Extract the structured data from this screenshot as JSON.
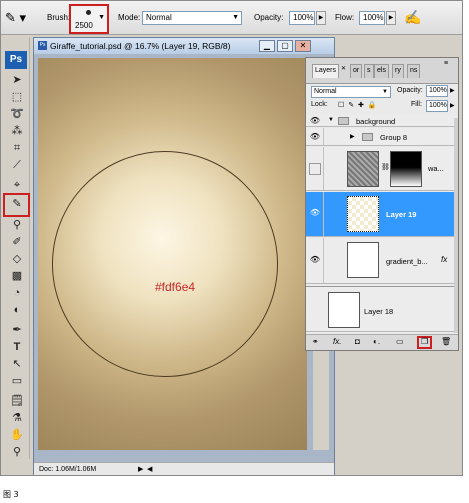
{
  "options_bar": {
    "brush_label": "Brush:",
    "brush_size": "2500",
    "mode_label": "Mode:",
    "mode_value": "Normal",
    "opacity_label": "Opacity:",
    "opacity_value": "100%",
    "flow_label": "Flow:",
    "flow_value": "100%"
  },
  "document": {
    "title": "Giraffe_tutorial.psd @ 16.7% (Layer 19, RGB/8)",
    "canvas_label": "#fdf6e4",
    "status": "Doc: 1.06M/1.06M"
  },
  "layers_panel": {
    "tabs": [
      "Layers",
      "or",
      "s",
      "els",
      "ry",
      "ns"
    ],
    "blend_mode": "Normal",
    "opacity_label": "Opacity:",
    "opacity_value": "100%",
    "lock_label": "Lock:",
    "fill_label": "Fill:",
    "fill_value": "100%",
    "rows": {
      "background": "background",
      "group8": "Group 8",
      "wa": "wa...",
      "layer19": "Layer 19",
      "gradient": "gradient_b...",
      "layer18": "Layer 18"
    }
  },
  "toolbox": {
    "logo": "Ps"
  },
  "caption": "图 3",
  "colors": {
    "highlight": "#cc1f1f",
    "selection": "#3399ff",
    "canvas_center": "#fdf6e4"
  }
}
